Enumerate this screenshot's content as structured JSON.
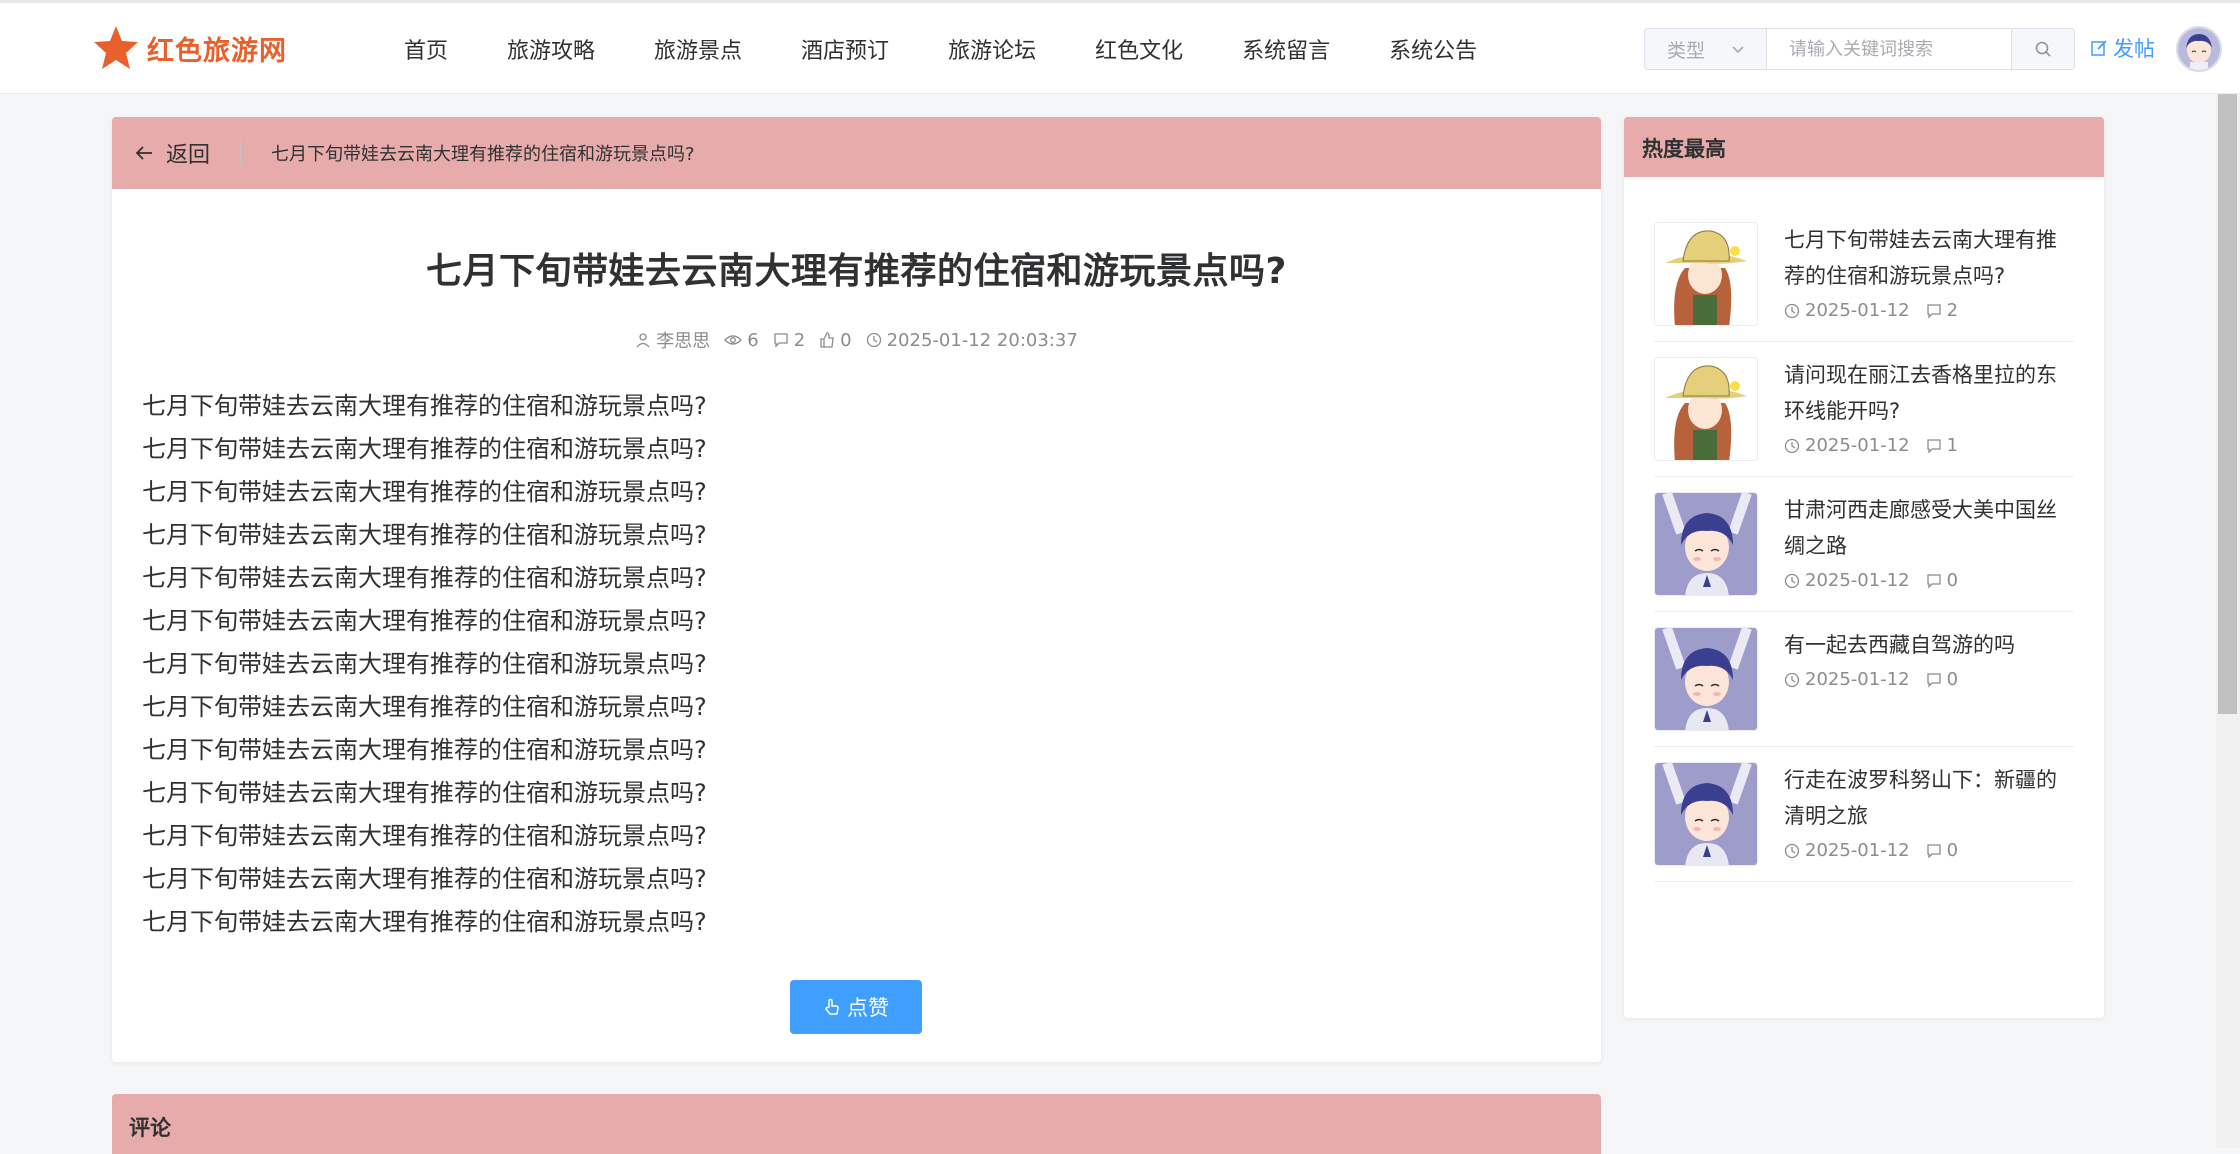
{
  "header": {
    "logo_text": "红色旅游网",
    "nav": [
      "首页",
      "旅游攻略",
      "旅游景点",
      "酒店预订",
      "旅游论坛",
      "红色文化",
      "系统留言",
      "系统公告"
    ],
    "search_type_placeholder": "类型",
    "search_placeholder": "请输入关键词搜索",
    "post_label": "发帖"
  },
  "breadcrumb": {
    "back_label": "返回",
    "title": "七月下旬带娃去云南大理有推荐的住宿和游玩景点吗?"
  },
  "post": {
    "title": "七月下旬带娃去云南大理有推荐的住宿和游玩景点吗?",
    "author": "李思思",
    "views": "6",
    "comments": "2",
    "likes": "0",
    "time": "2025-01-12 20:03:37",
    "content_lines": [
      "七月下旬带娃去云南大理有推荐的住宿和游玩景点吗?",
      "七月下旬带娃去云南大理有推荐的住宿和游玩景点吗?",
      "七月下旬带娃去云南大理有推荐的住宿和游玩景点吗?",
      "七月下旬带娃去云南大理有推荐的住宿和游玩景点吗?",
      "七月下旬带娃去云南大理有推荐的住宿和游玩景点吗?",
      "七月下旬带娃去云南大理有推荐的住宿和游玩景点吗?",
      "七月下旬带娃去云南大理有推荐的住宿和游玩景点吗?",
      "七月下旬带娃去云南大理有推荐的住宿和游玩景点吗?",
      "七月下旬带娃去云南大理有推荐的住宿和游玩景点吗?",
      "七月下旬带娃去云南大理有推荐的住宿和游玩景点吗?",
      "七月下旬带娃去云南大理有推荐的住宿和游玩景点吗?",
      "七月下旬带娃去云南大理有推荐的住宿和游玩景点吗?",
      "七月下旬带娃去云南大理有推荐的住宿和游玩景点吗?"
    ],
    "like_button": "点赞"
  },
  "comments_section": {
    "title": "评论"
  },
  "sidebar": {
    "title": "热度最高",
    "items": [
      {
        "title": "七月下旬带娃去云南大理有推荐的住宿和游玩景点吗?",
        "date": "2025-01-12",
        "comments": "2",
        "thumb": "girl"
      },
      {
        "title": "请问现在丽江去香格里拉的东环线能开吗?",
        "date": "2025-01-12",
        "comments": "1",
        "thumb": "girl"
      },
      {
        "title": "甘肃河西走廊感受大美中国丝绸之路",
        "date": "2025-01-12",
        "comments": "0",
        "thumb": "boy"
      },
      {
        "title": "有一起去西藏自驾游的吗",
        "date": "2025-01-12",
        "comments": "0",
        "thumb": "boy"
      },
      {
        "title": "行走在波罗科努山下：新疆的清明之旅",
        "date": "2025-01-12",
        "comments": "0",
        "thumb": "boy"
      }
    ]
  },
  "colors": {
    "accent": "#409eff",
    "section_header": "#e8abab",
    "logo": "#e8612c"
  }
}
